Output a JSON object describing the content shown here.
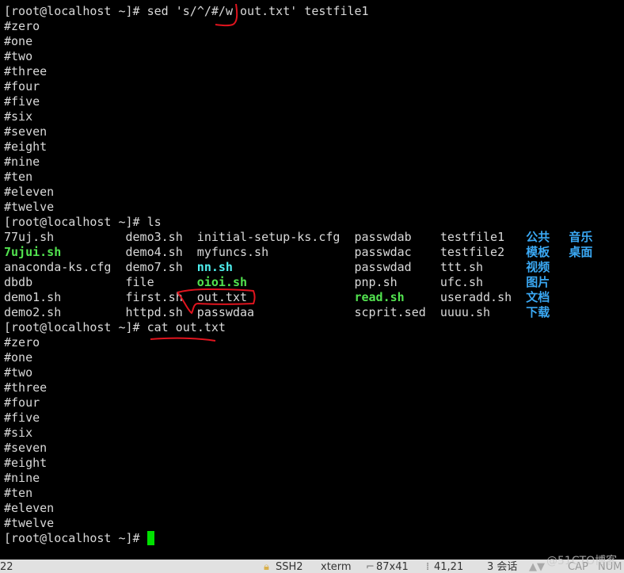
{
  "colors": {
    "text": "#d9d9d9",
    "exec": "#52e34f",
    "link": "#4ff0ef",
    "dir": "#3aa8f3",
    "cursor": "#00e000",
    "annotation": "#e0141e"
  },
  "terminal": {
    "lines": [
      {
        "text": "[root@localhost ~]# sed 's/^/#/w out.txt' testfile1"
      },
      {
        "text": "#zero"
      },
      {
        "text": "#one"
      },
      {
        "text": "#two"
      },
      {
        "text": "#three"
      },
      {
        "text": "#four"
      },
      {
        "text": "#five"
      },
      {
        "text": "#six"
      },
      {
        "text": "#seven"
      },
      {
        "text": "#eight"
      },
      {
        "text": "#nine"
      },
      {
        "text": "#ten"
      },
      {
        "text": "#eleven"
      },
      {
        "text": "#twelve"
      },
      {
        "text": "[root@localhost ~]# ls"
      },
      {
        "cols": [
          {
            "t": "77uj.sh"
          },
          {
            "t": "demo3.sh"
          },
          {
            "t": "initial-setup-ks.cfg"
          },
          {
            "t": "passwdab"
          },
          {
            "t": "testfile1"
          },
          {
            "t": "公共",
            "c": "dir"
          },
          {
            "t": "音乐",
            "c": "dir"
          }
        ]
      },
      {
        "cols": [
          {
            "t": "7ujui.sh",
            "c": "exec"
          },
          {
            "t": "demo4.sh"
          },
          {
            "t": "myfuncs.sh"
          },
          {
            "t": "passwdac"
          },
          {
            "t": "testfile2"
          },
          {
            "t": "模板",
            "c": "dir"
          },
          {
            "t": "桌面",
            "c": "dir"
          }
        ]
      },
      {
        "cols": [
          {
            "t": "anaconda-ks.cfg"
          },
          {
            "t": "demo7.sh"
          },
          {
            "t": "nn.sh",
            "c": "link"
          },
          {
            "t": "passwdad"
          },
          {
            "t": "ttt.sh"
          },
          {
            "t": "视频",
            "c": "dir"
          },
          {
            "t": ""
          }
        ]
      },
      {
        "cols": [
          {
            "t": "dbdb"
          },
          {
            "t": "file"
          },
          {
            "t": "oioi.sh",
            "c": "exec"
          },
          {
            "t": "pnp.sh"
          },
          {
            "t": "ufc.sh"
          },
          {
            "t": "图片",
            "c": "dir"
          },
          {
            "t": ""
          }
        ]
      },
      {
        "cols": [
          {
            "t": "demo1.sh"
          },
          {
            "t": "first.sh"
          },
          {
            "t": "out.txt"
          },
          {
            "t": "read.sh",
            "c": "exec"
          },
          {
            "t": "useradd.sh"
          },
          {
            "t": "文档",
            "c": "dir"
          },
          {
            "t": ""
          }
        ]
      },
      {
        "cols": [
          {
            "t": "demo2.sh"
          },
          {
            "t": "httpd.sh"
          },
          {
            "t": "passwdaa"
          },
          {
            "t": "scprit.sed"
          },
          {
            "t": "uuuu.sh"
          },
          {
            "t": "下载",
            "c": "dir"
          },
          {
            "t": ""
          }
        ]
      },
      {
        "text": "[root@localhost ~]# cat out.txt"
      },
      {
        "text": "#zero"
      },
      {
        "text": "#one"
      },
      {
        "text": "#two"
      },
      {
        "text": "#three"
      },
      {
        "text": "#four"
      },
      {
        "text": "#five"
      },
      {
        "text": "#six"
      },
      {
        "text": "#seven"
      },
      {
        "text": "#eight"
      },
      {
        "text": "#nine"
      },
      {
        "text": "#ten"
      },
      {
        "text": "#eleven"
      },
      {
        "text": "#twelve"
      },
      {
        "text": "[root@localhost ~]# "
      }
    ]
  },
  "status_bar": {
    "left": "22",
    "protocol": "SSH2",
    "term_type": "xterm",
    "size": "87x41",
    "cursor_pos": "41,21",
    "sessions": "3 会话",
    "caps": "CAP",
    "num": "NUM",
    "lock_icon": "lock-icon",
    "size_icon": "resize-icon",
    "pos_icon": "cursor-position-icon",
    "arrows_icon": "scroll-arrows-icon"
  },
  "watermark": "@51CTO博客"
}
